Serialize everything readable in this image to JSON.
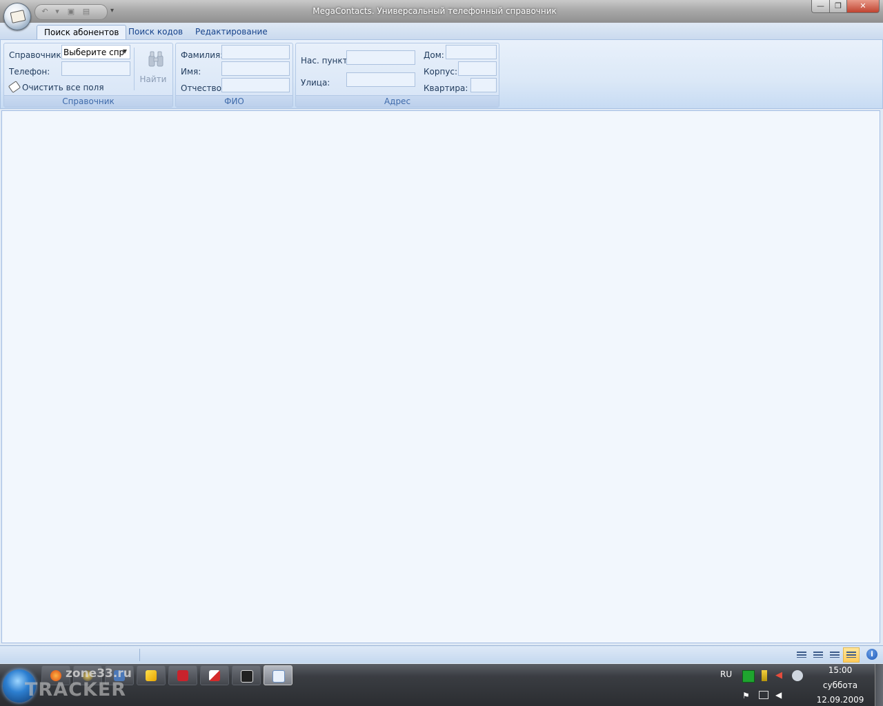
{
  "window": {
    "title": "MegaContacts. Универсальный телефонный справочник",
    "min_label": "—",
    "max_label": "❐",
    "close_label": "✕"
  },
  "quick_access": {
    "more_label": "▾"
  },
  "tabs": [
    {
      "label": "Поиск абонентов",
      "active": true
    },
    {
      "label": "Поиск кодов",
      "active": false
    },
    {
      "label": "Редактирование",
      "active": false
    }
  ],
  "groups": {
    "directory": {
      "caption": "Справочник",
      "directory_label": "Справочник:",
      "directory_value": "Выберите спр",
      "phone_label": "Телефон:",
      "phone_value": "",
      "clear_label": "Очистить все поля",
      "find_label": "Найти"
    },
    "fio": {
      "caption": "ФИО",
      "surname_label": "Фамилия:",
      "surname_value": "",
      "name_label": "Имя:",
      "name_value": "",
      "patronymic_label": "Отчество:",
      "patronymic_value": ""
    },
    "address": {
      "caption": "Адрес",
      "locality_label": "Нас. пункт:",
      "locality_value": "",
      "street_label": "Улица:",
      "street_value": "",
      "house_label": "Дом:",
      "house_value": "",
      "building_label": "Корпус:",
      "building_value": "",
      "apartment_label": "Квартира:",
      "apartment_value": ""
    }
  },
  "statusbar": {
    "info_icon_label": "i"
  },
  "taskbar": {
    "watermark_top": "zone33.ru",
    "watermark_bottom": "TRACKER",
    "language": "RU",
    "time": "15:00",
    "day": "суббота",
    "date": "12.09.2009"
  }
}
